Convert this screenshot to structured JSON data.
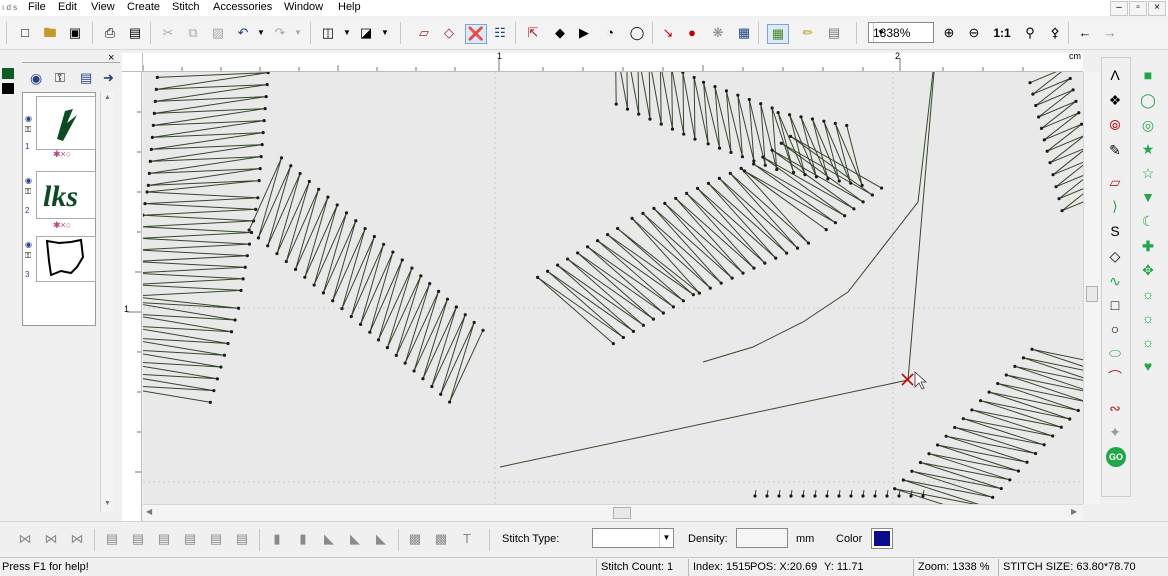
{
  "menu": {
    "items": [
      "File",
      "Edit",
      "View",
      "Create",
      "Stitch",
      "Accessories",
      "Window",
      "Help"
    ],
    "app_glyph": "ı d s",
    "window_buttons": [
      "–",
      "▫",
      "×"
    ]
  },
  "toolbar": {
    "zoom_value": "1338%",
    "icons": [
      "new-file-icon",
      "open-folder-icon",
      "save-icon",
      "print-icon",
      "print-preview-icon",
      "cut-icon",
      "copy-icon",
      "paste-icon",
      "undo-icon",
      "redo-icon",
      "export-icon",
      "import-icon",
      "stitch-tool-icon",
      "zoom-in-icon",
      "zoom-out-icon",
      "zoom-actual-icon",
      "zoom-fit-icon",
      "zoom-window-icon",
      "arrow-left-icon",
      "arrow-right-icon"
    ]
  },
  "left_panel": {
    "close_glyph": "×",
    "layer_numbers": [
      "1",
      "2",
      "3"
    ]
  },
  "ruler": {
    "top_labels": [
      "1",
      "2"
    ],
    "unit": "cm",
    "left_labels": [
      "1"
    ]
  },
  "bottom": {
    "stitch_type_label": "Stitch Type:",
    "stitch_type_value": "",
    "density_label": "Density:",
    "density_value": "",
    "density_unit": "mm",
    "color_label": "Color",
    "color_value": "#0b0b8f"
  },
  "status": {
    "help": "Press F1 for help!",
    "stitch_count": "Stitch Count: 1",
    "index": "Index: 1515",
    "pos_x": "POS: X:20.69",
    "pos_y": "Y: 11.71",
    "zoom": "Zoom: 1338 %",
    "stitch_size": "STITCH SIZE: 63.80*78.70"
  },
  "colors": {
    "stitch": "#3a4a30",
    "accent_green": "#1fa84a",
    "marker": "#cc0000"
  }
}
